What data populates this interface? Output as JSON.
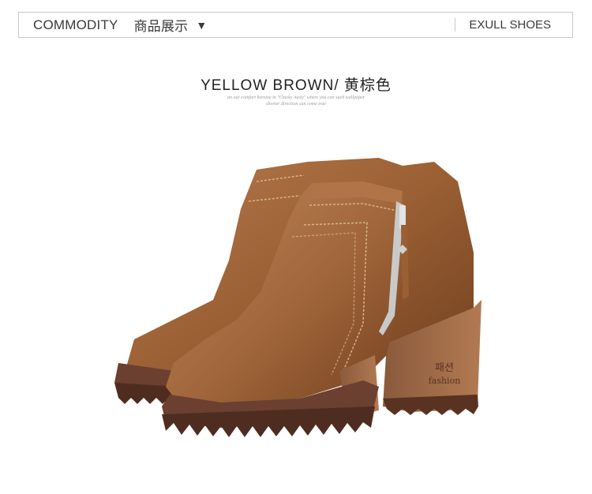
{
  "header": {
    "commodity_label": "COMMODITY",
    "cn_label": "商品展示",
    "dropdown_icon": "▼",
    "brand_label": "EXULL SHOES"
  },
  "product": {
    "color_title": "YELLOW BROWN/ 黄棕色",
    "fine_print_line1": "an our comfort heroine in \"Chicky Away\" where you can such wallpaper",
    "fine_print_line2": "shorter direction can come true",
    "sole_text_top": "패션",
    "sole_text_bottom": "fashion"
  },
  "colors": {
    "leather": "#9a5f33",
    "sole": "#6b4030",
    "stitch": "#d8b48a",
    "zipper": "#c9c9c9"
  }
}
